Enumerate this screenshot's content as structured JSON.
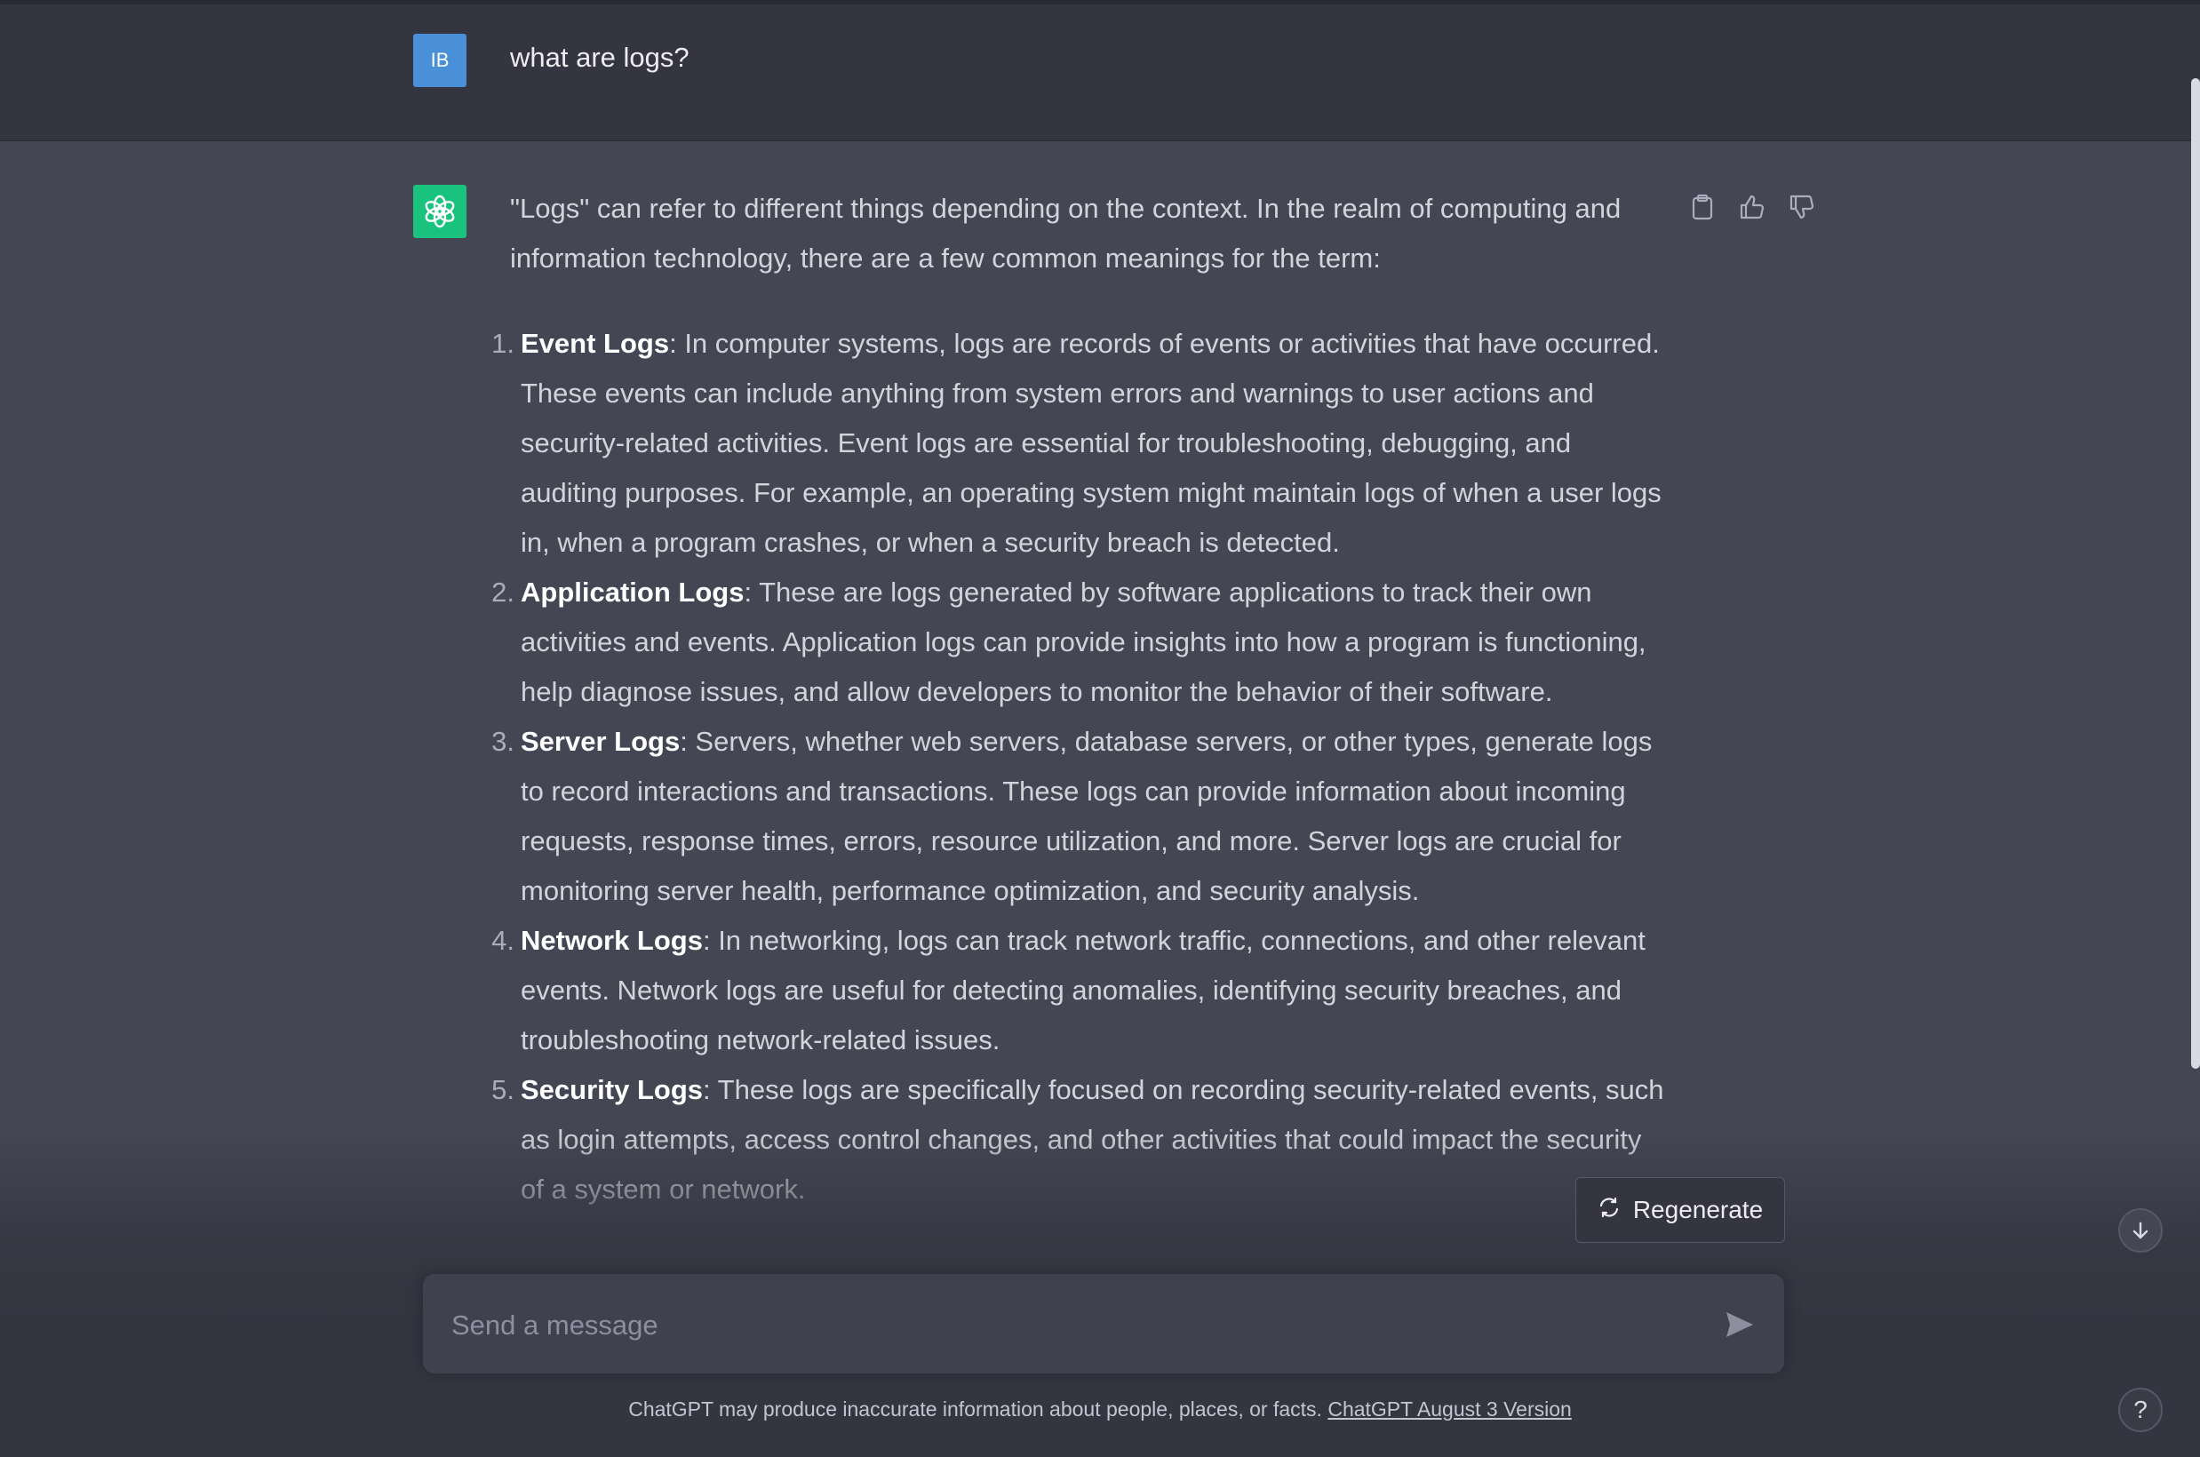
{
  "user_message": {
    "avatar_initials": "IB",
    "text": "what are logs?"
  },
  "assistant_message": {
    "intro": "\"Logs\" can refer to different things depending on the context. In the realm of computing and information technology, there are a few common meanings for the term:",
    "items": [
      {
        "number": "1.",
        "title": "Event Logs",
        "text": ": In computer systems, logs are records of events or activities that have occurred. These events can include anything from system errors and warnings to user actions and security-related activities. Event logs are essential for troubleshooting, debugging, and auditing purposes. For example, an operating system might maintain logs of when a user logs in, when a program crashes, or when a security breach is detected."
      },
      {
        "number": "2.",
        "title": "Application Logs",
        "text": ": These are logs generated by software applications to track their own activities and events. Application logs can provide insights into how a program is functioning, help diagnose issues, and allow developers to monitor the behavior of their software."
      },
      {
        "number": "3.",
        "title": "Server Logs",
        "text": ": Servers, whether web servers, database servers, or other types, generate logs to record interactions and transactions. These logs can provide information about incoming requests, response times, errors, resource utilization, and more. Server logs are crucial for monitoring server health, performance optimization, and security analysis."
      },
      {
        "number": "4.",
        "title": "Network Logs",
        "text": ": In networking, logs can track network traffic, connections, and other relevant events. Network logs are useful for detecting anomalies, identifying security breaches, and troubleshooting network-related issues."
      },
      {
        "number": "5.",
        "title": "Security Logs",
        "text": ": These logs are specifically focused on recording security-related events, such as login attempts, access control changes, and other activities that could impact the security of a system or network."
      }
    ]
  },
  "actions": {
    "regenerate_label": "Regenerate"
  },
  "composer": {
    "placeholder": "Send a message"
  },
  "footer": {
    "disclaimer": "ChatGPT may produce inaccurate information about people, places, or facts. ",
    "version_link": "ChatGPT August 3 Version"
  },
  "help_label": "?",
  "icons": [
    "copy-icon",
    "thumbs-up-icon",
    "thumbs-down-icon",
    "regenerate-icon",
    "send-icon",
    "arrow-down-icon",
    "openai-logo-icon"
  ],
  "colors": {
    "user_bg": "#343541",
    "assistant_bg": "#444654",
    "brand_green": "#19c37d",
    "user_avatar": "#4a90d9"
  }
}
